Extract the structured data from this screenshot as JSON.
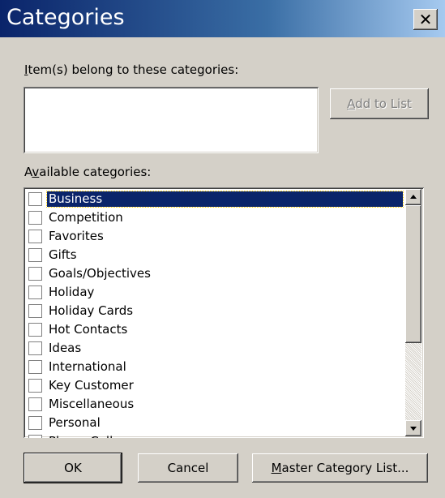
{
  "window": {
    "title": "Categories",
    "close_glyph": "✕"
  },
  "assigned": {
    "label_mnemonic": "I",
    "label_rest": "tem(s) belong to these categories:",
    "value": "",
    "add_button_mnemonic": "A",
    "add_button_rest": "dd to List"
  },
  "available": {
    "label_pre": "A",
    "label_mnemonic": "v",
    "label_rest": "ailable categories:",
    "items": [
      {
        "label": "Business",
        "checked": false,
        "selected": true
      },
      {
        "label": "Competition",
        "checked": false,
        "selected": false
      },
      {
        "label": "Favorites",
        "checked": false,
        "selected": false
      },
      {
        "label": "Gifts",
        "checked": false,
        "selected": false
      },
      {
        "label": "Goals/Objectives",
        "checked": false,
        "selected": false
      },
      {
        "label": "Holiday",
        "checked": false,
        "selected": false
      },
      {
        "label": "Holiday Cards",
        "checked": false,
        "selected": false
      },
      {
        "label": "Hot Contacts",
        "checked": false,
        "selected": false
      },
      {
        "label": "Ideas",
        "checked": false,
        "selected": false
      },
      {
        "label": "International",
        "checked": false,
        "selected": false
      },
      {
        "label": "Key Customer",
        "checked": false,
        "selected": false
      },
      {
        "label": "Miscellaneous",
        "checked": false,
        "selected": false
      },
      {
        "label": "Personal",
        "checked": false,
        "selected": false
      },
      {
        "label": "Phone Calls",
        "checked": false,
        "selected": false
      }
    ]
  },
  "buttons": {
    "ok": "OK",
    "cancel": "Cancel",
    "master_mnemonic": "M",
    "master_rest": "aster Category List..."
  }
}
